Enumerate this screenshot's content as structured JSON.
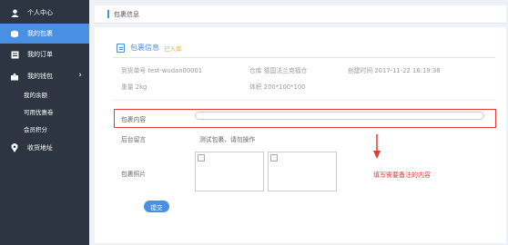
{
  "sidebar": {
    "items": [
      {
        "label": "个人中心",
        "icon": "user-icon"
      },
      {
        "label": "我的包裹",
        "icon": "package-icon"
      },
      {
        "label": "我的订单",
        "icon": "order-icon"
      },
      {
        "label": "我的钱包",
        "icon": "wallet-icon"
      },
      {
        "label": "我的余额"
      },
      {
        "label": "可用优惠卷"
      },
      {
        "label": "会员积分"
      },
      {
        "label": "收货地址",
        "icon": "location-icon"
      }
    ]
  },
  "breadcrumb": "包裹信息",
  "panel": {
    "title": "包裹信息",
    "status": "已入库",
    "info": {
      "tracking": "到货单号 test-wudan00001",
      "warehouse": "仓库 德国法兰克福仓",
      "created": "创建时间 2017-11-22 16:19:38",
      "weight": "重量 2kg",
      "volume": "体积 200*100*100"
    },
    "remark_label": "包裹内容",
    "remark_value": "",
    "backend_label": "后台留言",
    "backend_msg": "测试包裹，请勿操作",
    "photo_label": "包裹照片",
    "submit": "提交"
  },
  "annotation": "填写需要备注的内容",
  "colors": {
    "accent": "#4a90e2",
    "highlight": "#e53935",
    "sidebar": "#2c3541",
    "status": "#f5a623"
  }
}
